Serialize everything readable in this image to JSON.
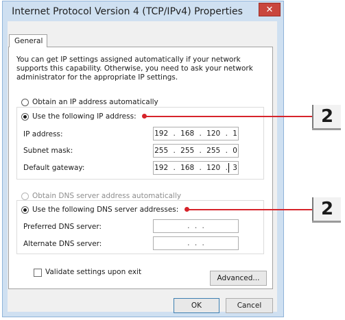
{
  "window": {
    "title": "Internet Protocol Version 4 (TCP/IPv4) Properties",
    "close_glyph": "✕"
  },
  "tabs": [
    {
      "label": "General"
    }
  ],
  "description": "You can get IP settings assigned automatically if your network supports this capability. Otherwise, you need to ask your network administrator for the appropriate IP settings.",
  "ip": {
    "auto_label": "Obtain an IP address automatically",
    "auto_selected": false,
    "manual_label": "Use the following IP address:",
    "manual_selected": true,
    "fields": [
      {
        "label": "IP address:",
        "value": "192 . 168 . 120 .  1"
      },
      {
        "label": "Subnet mask:",
        "value": "255 . 255 . 255 .  0"
      },
      {
        "label": "Default gateway:",
        "value": "192 . 168 . 120 .  3"
      }
    ]
  },
  "dns": {
    "auto_label": "Obtain DNS server address automatically",
    "auto_enabled": false,
    "manual_label": "Use the following DNS server addresses:",
    "manual_selected": true,
    "fields": [
      {
        "label": "Preferred DNS server:",
        "value": ".     .     ."
      },
      {
        "label": "Alternate DNS server:",
        "value": ".     .     ."
      }
    ]
  },
  "validate_label": "Validate settings upon exit",
  "validate_checked": false,
  "buttons": {
    "advanced": "Advanced...",
    "ok": "OK",
    "cancel": "Cancel"
  },
  "callouts": [
    {
      "label": "2",
      "target": "ip-manual-radio"
    },
    {
      "label": "2",
      "target": "dns-manual-radio"
    }
  ],
  "colors": {
    "callout": "#d6232a",
    "close_button": "#c9463d",
    "window_frame": "#cfe0f1"
  }
}
